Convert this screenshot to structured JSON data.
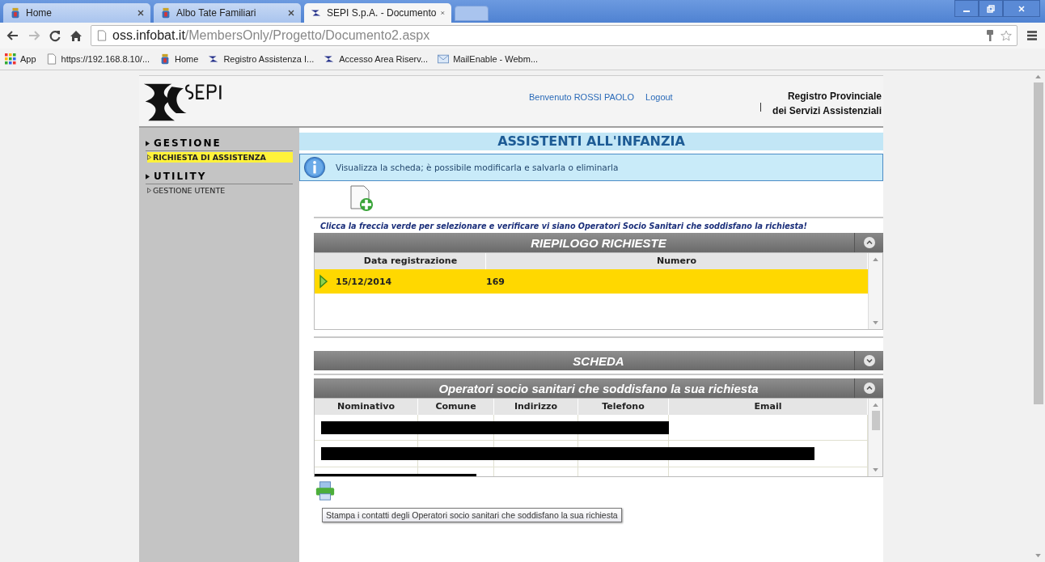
{
  "browser": {
    "tabs": [
      {
        "title": "Home",
        "kind": "crest",
        "selected": false
      },
      {
        "title": "Albo Tate Familiari",
        "kind": "crest",
        "selected": false
      },
      {
        "title": "SEPI S.p.A. - Documento",
        "kind": "sepi",
        "selected": true
      }
    ],
    "address": {
      "host": "oss.infobat.it",
      "path": "/MembersOnly/Progetto/Documento2.aspx"
    },
    "bookmarks": [
      {
        "label": "App",
        "kind": "apps"
      },
      {
        "label": "https://192.168.8.10/...",
        "kind": "page"
      },
      {
        "label": "Home",
        "kind": "crest"
      },
      {
        "label": "Registro Assistenza I...",
        "kind": "sepi"
      },
      {
        "label": "Accesso Area Riserv...",
        "kind": "sepi"
      },
      {
        "label": "MailEnable - Webm...",
        "kind": "mail"
      }
    ]
  },
  "header": {
    "welcome": "Benvenuto ROSSI PAOLO",
    "logout": "Logout",
    "title_lines": [
      "Registro Provinciale",
      "dei Servizi Assistenziali"
    ]
  },
  "sidebar": {
    "sections": [
      {
        "label": "GESTIONE",
        "items": [
          {
            "label": "RICHIESTA DI ASSISTENZA",
            "selected": true
          }
        ]
      },
      {
        "label": "UTILITY",
        "items": [
          {
            "label": "GESTIONE UTENTE",
            "selected": false
          }
        ]
      }
    ]
  },
  "page_title": "ASSISTENTI ALL'INFANZIA",
  "info": "Visualizza la scheda; è possibile modificarla e salvarla o eliminarla",
  "instruction": "Clicca la freccia verde per selezionare e verificare vi siano Operatori Socio Sanitari che soddisfano la richiesta!",
  "requests": {
    "title": "RIEPILOGO RICHIESTE",
    "expanded": true,
    "columns": [
      "Data registrazione",
      "Numero"
    ],
    "rows": [
      {
        "date": "15/12/2014",
        "number": "169",
        "selected": true
      }
    ]
  },
  "scheda": {
    "title": "SCHEDA",
    "expanded": false
  },
  "operators": {
    "title": "Operatori socio sanitari che soddisfano la sua richiesta",
    "expanded": true,
    "columns": [
      "Nominativo",
      "Comune",
      "Indirizzo",
      "Telefono",
      "Email"
    ],
    "rows": [
      {
        "kind": "redacted"
      },
      {
        "kind": "redacted"
      },
      {
        "kind": "redacted"
      }
    ]
  },
  "tooltip": "Stampa i contatti degli Operatori socio sanitari che soddisfano la sua richiesta"
}
